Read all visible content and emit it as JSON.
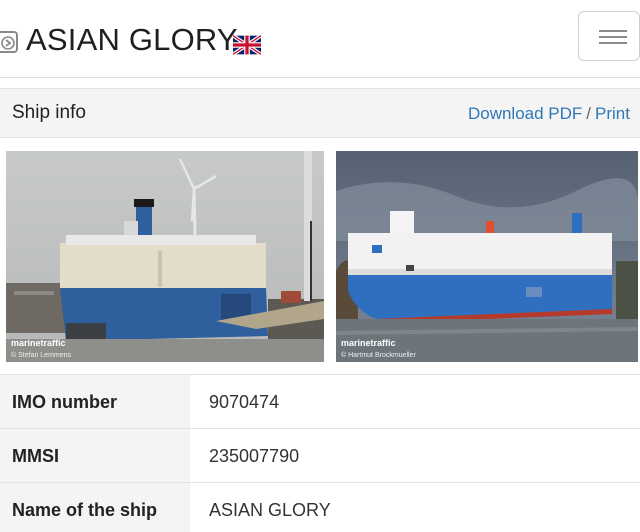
{
  "header": {
    "title": "ASIAN GLORY",
    "flag_icon": "uk-flag-icon",
    "back_icon": "arrow-right-box-icon",
    "menu_icon": "hamburger-menu-icon"
  },
  "info_bar": {
    "title": "Ship info",
    "download_label": "Download PDF",
    "separator": "/",
    "print_label": "Print"
  },
  "photos": [
    {
      "watermark": "marinetraffic",
      "credit": "© Stefan Lemmens"
    },
    {
      "watermark": "marinetraffic",
      "credit": "© Hartmut Brockmueller"
    }
  ],
  "details": [
    {
      "label": "IMO number",
      "value": "9070474"
    },
    {
      "label": "MMSI",
      "value": "235007790"
    },
    {
      "label": "Name of the ship",
      "value": "ASIAN GLORY"
    }
  ],
  "colors": {
    "link": "#2f78b8",
    "hull_blue": "#2f6fbf",
    "row_label_bg": "#f4f4f4"
  }
}
